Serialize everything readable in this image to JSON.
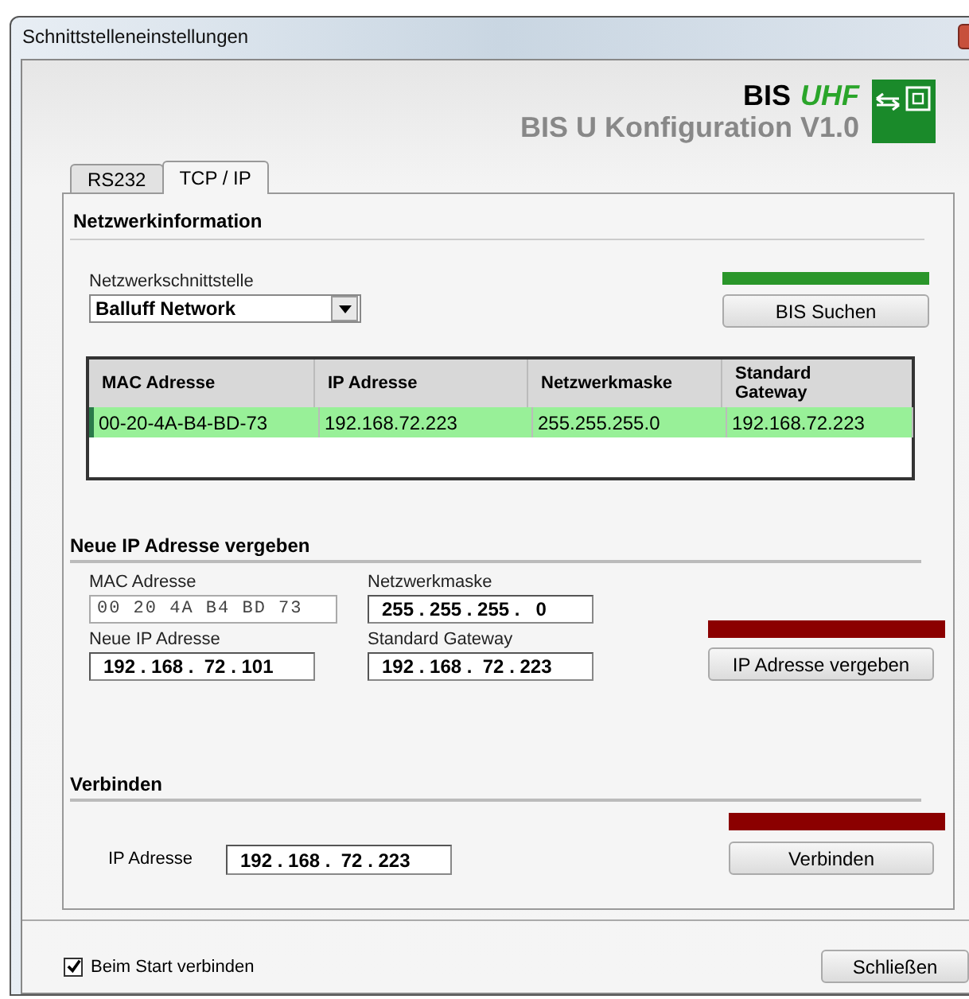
{
  "window": {
    "title": "Schnittstelleneinstellungen"
  },
  "header": {
    "brand": "BIS",
    "brand_suffix": "UHF",
    "subtitle": "BIS U Konfiguration V1.0"
  },
  "tabs": [
    {
      "label": "RS232",
      "selected": false
    },
    {
      "label": "TCP / IP",
      "selected": true
    }
  ],
  "network_info": {
    "heading": "Netzwerkinformation",
    "interface_label": "Netzwerkschnittstelle",
    "interface_value": "Balluff Network",
    "indicator": {
      "color": "#2a962a"
    },
    "search_button": "BIS Suchen",
    "table": {
      "columns": [
        "MAC Adresse",
        "IP Adresse",
        "Netzwerkmaske",
        "Standard Gateway"
      ],
      "rows": [
        {
          "cells": [
            "00-20-4A-B4-BD-73",
            "192.168.72.223",
            "255.255.255.0",
            "192.168.72.223"
          ],
          "selected": true
        }
      ]
    }
  },
  "assign": {
    "heading": "Neue IP Adresse vergeben",
    "mac_label": "MAC Adresse",
    "mac_value": "00 20 4A B4 BD 73",
    "mask_label": "Netzwerkmaske",
    "mask": "255 . 255 . 255 .   0",
    "new_ip_label": "Neue IP Adresse",
    "new_ip": "192 . 168 .  72 . 101",
    "gateway_label": "Standard Gateway",
    "gateway": "192 . 168 .  72 . 223",
    "indicator": {
      "color": "#8b0000"
    },
    "button": "IP Adresse vergeben"
  },
  "connect": {
    "heading": "Verbinden",
    "ip_label": "IP Adresse",
    "ip": "192 . 168 .  72 . 223",
    "indicator": {
      "color": "#8b0000"
    },
    "button": "Verbinden"
  },
  "footer": {
    "autoconnect_label": "Beim Start verbinden",
    "autoconnect_checked": true,
    "close_button": "Schließen"
  }
}
